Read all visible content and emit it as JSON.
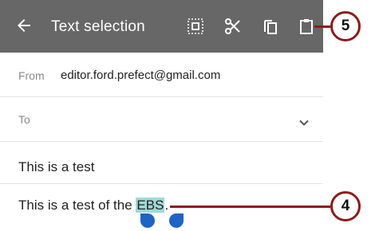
{
  "appbar": {
    "title": "Text selection",
    "icons": [
      "back-arrow-icon",
      "select-all-icon",
      "cut-icon",
      "copy-icon",
      "paste-icon"
    ]
  },
  "compose": {
    "from_label": "From",
    "from_value": "editor.ford.prefect@gmail.com",
    "to_label": "To",
    "subject": "This is a test",
    "body_before": "This is a test of the ",
    "body_selected": "EBS",
    "body_after": "."
  },
  "callouts": {
    "top": "5",
    "bottom": "4"
  },
  "colors": {
    "appbar": "#676767",
    "selection": "#9fd8d8",
    "handle": "#1f63c6",
    "callout": "#8b1a1a"
  }
}
